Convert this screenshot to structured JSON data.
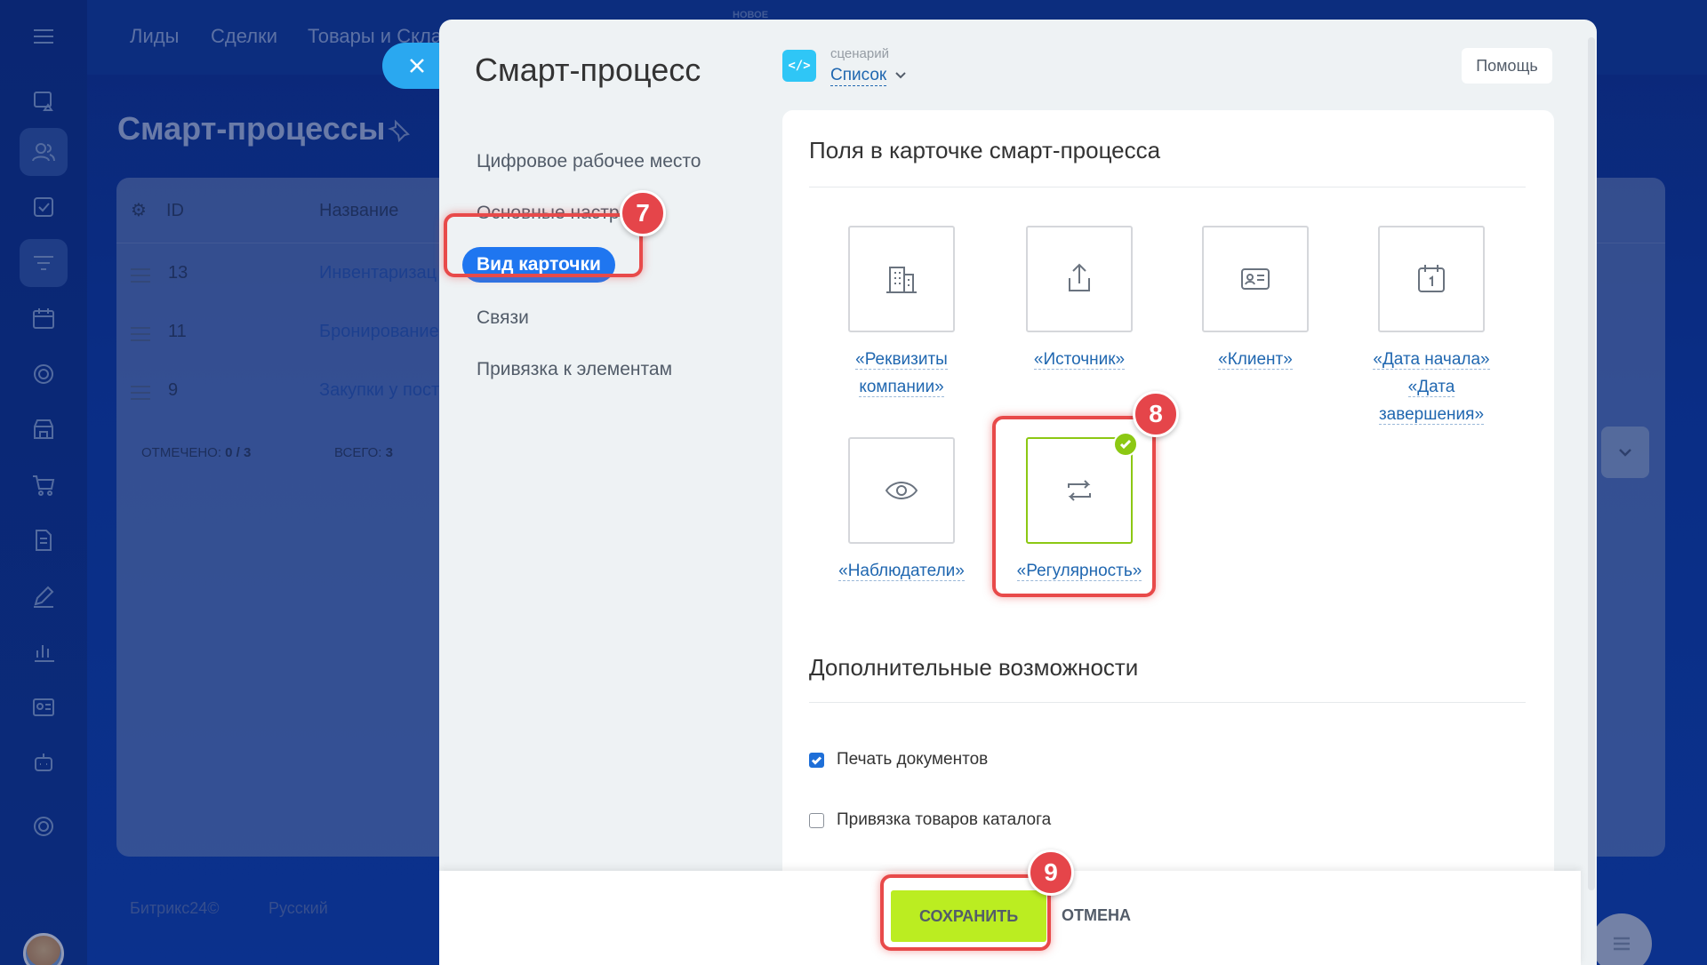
{
  "background": {
    "nav": [
      "Лиды",
      "Сделки",
      "Товары и Скла"
    ],
    "nav_badge": "НОВОЕ",
    "title": "Смарт-процессы",
    "table": {
      "headers": [
        "ID",
        "Название"
      ],
      "rows": [
        {
          "id": "13",
          "name": "Инвентаризац"
        },
        {
          "id": "11",
          "name": "Бронирование"
        },
        {
          "id": "9",
          "name": "Закупки у пост"
        }
      ],
      "selected_label": "ОТМЕЧЕНО:",
      "selected_value": "0 / 3",
      "total_label": "ВСЕГО:",
      "total_value": "3"
    },
    "footer": [
      "Битрикс24©",
      "Русский"
    ]
  },
  "slider": {
    "title": "Смарт-процесс",
    "script_label": "сценарий",
    "script_value": "Список",
    "help": "Помощь",
    "menu": [
      {
        "label": "Цифровое рабочее место",
        "active": false
      },
      {
        "label": "Основные настройки",
        "active": false
      },
      {
        "label": "Вид карточки",
        "active": true
      },
      {
        "label": "Связи",
        "active": false
      },
      {
        "label": "Привязка к элементам",
        "active": false
      }
    ],
    "fields_title": "Поля в карточке смарт-процесса",
    "tiles": [
      {
        "label": "«Реквизиты компании»",
        "icon": "building-icon",
        "selected": false
      },
      {
        "label": "«Источник»",
        "icon": "share-icon",
        "selected": false
      },
      {
        "label": "«Клиент»",
        "icon": "contact-card-icon",
        "selected": false
      },
      {
        "label": "«Дата начала» «Дата завершения»",
        "icon": "calendar-icon",
        "selected": false
      },
      {
        "label": "«Наблюдатели»",
        "icon": "eye-icon",
        "selected": false
      },
      {
        "label": "«Регулярность»",
        "icon": "repeat-icon",
        "selected": true
      }
    ],
    "extra_title": "Дополнительные возможности",
    "options": [
      {
        "label": "Печать документов",
        "checked": true
      },
      {
        "label": "Привязка товаров каталога",
        "checked": false
      }
    ],
    "save": "СОХРАНИТЬ",
    "cancel": "ОТМЕНА"
  },
  "annotations": {
    "steps": [
      "7",
      "8",
      "9"
    ],
    "color": "#e5454a"
  },
  "colors": {
    "accent": "#1f76f0",
    "save": "#bbed21",
    "selected_tile": "#8cc813",
    "link": "#2067b0"
  }
}
